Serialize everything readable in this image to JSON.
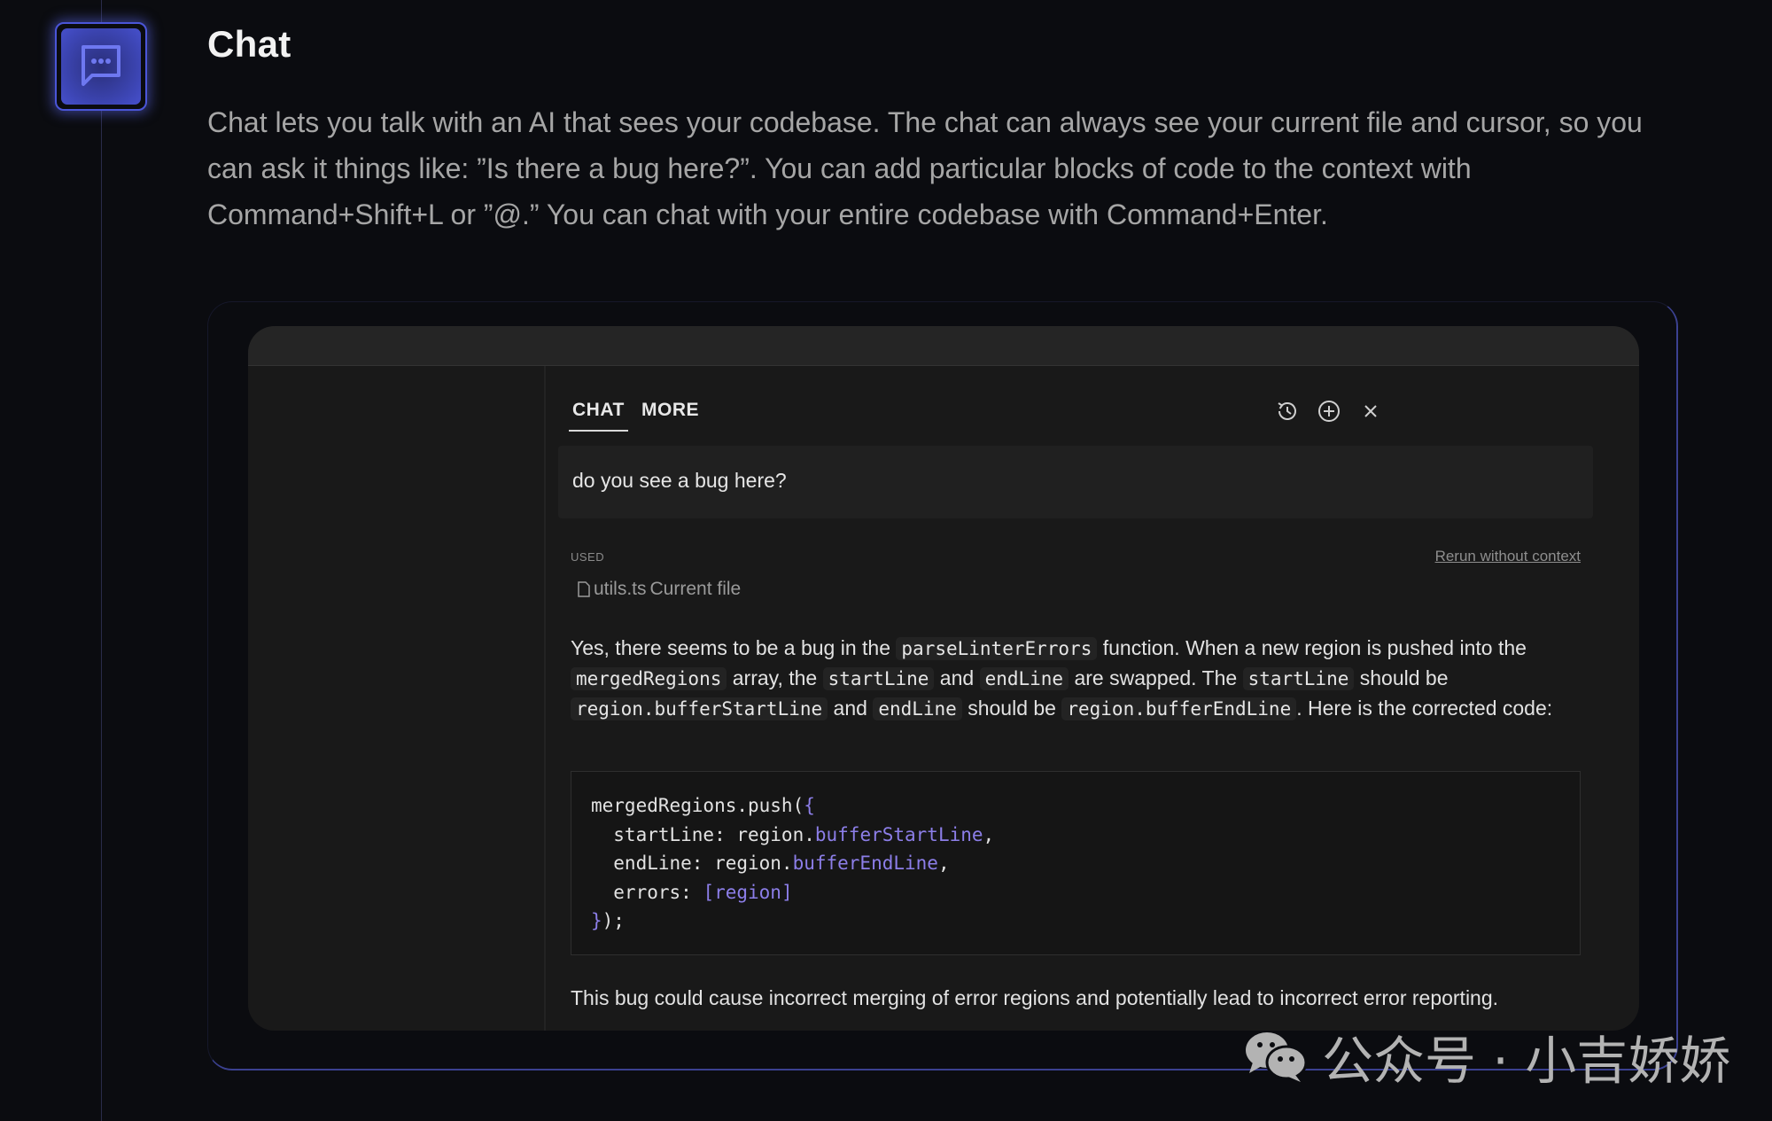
{
  "feature": {
    "icon": "chat-bubble-icon",
    "title": "Chat",
    "description": "Chat lets you talk with an AI that sees your codebase. The chat can always see your current file and cursor, so you can ask it things like: ”Is there a bug here?”. You can add particular blocks of code to the context with Command+Shift+L or ”@.” You can chat with your entire codebase with Command+Enter."
  },
  "panel": {
    "tabs": [
      {
        "label": "CHAT",
        "active": true
      },
      {
        "label": "MORE",
        "active": false
      }
    ],
    "actions": [
      {
        "icon": "history-icon"
      },
      {
        "icon": "new-chat-plus-icon"
      },
      {
        "icon": "close-icon"
      }
    ],
    "user_message": "do you see a bug here?",
    "context": {
      "used_label": "USED",
      "rerun_label": "Rerun without context",
      "file_name": "utils.ts",
      "file_note": "Current file"
    },
    "answer": {
      "t1": "Yes, there seems to be a bug in the ",
      "c1": "parseLinterErrors",
      "t2": " function. When a new region is pushed into the ",
      "c2": "mergedRegions",
      "t3": " array, the ",
      "c3": "startLine",
      "t4": " and ",
      "c4": "endLine",
      "t5": " are swapped. The ",
      "c5": "startLine",
      "t6": " should be ",
      "c6": "region.bufferStartLine",
      "t7": " and ",
      "c7": "endLine",
      "t8": " should be ",
      "c8": "region.bufferEndLine",
      "t9": ". Here is the corrected code:"
    },
    "code": {
      "l1a": "mergedRegions.push(",
      "l1b": "{",
      "l2a": "  startLine: region.",
      "l2b": "bufferStartLine",
      "l2c": ",",
      "l3a": "  endLine: region.",
      "l3b": "bufferEndLine",
      "l3c": ",",
      "l4a": "  errors: ",
      "l4b": "[region]",
      "l5a": "}",
      "l5b": ");"
    },
    "closing": "This bug could cause incorrect merging of error regions and potentially lead to incorrect error reporting."
  },
  "watermark": {
    "icon": "wechat-icon",
    "text": "公众号 · 小吉娇娇"
  },
  "colors": {
    "accent": "#4a55d8",
    "code_token": "#8c7ee8",
    "background": "#0b0c10",
    "window": "#191919"
  }
}
